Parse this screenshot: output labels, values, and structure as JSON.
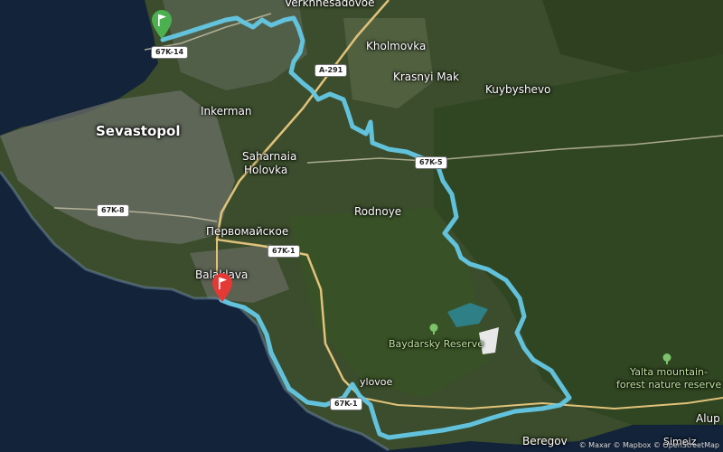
{
  "map": {
    "route_color": "#64c8e6",
    "start_marker": {
      "icon": "start-flag-icon",
      "color": "#4caf50"
    },
    "end_marker": {
      "icon": "finish-flag-icon",
      "color": "#e53935"
    },
    "cities": {
      "sevastopol": "Sevastopol"
    },
    "towns": {
      "verkhnesadovoe": "Verkhnesadovoe",
      "kholmovka": "Kholmovka",
      "krasnyi_mak": "Krasnyi Mak",
      "kuybyshevo": "Kuybyshevo",
      "inkerman": "Inkerman",
      "saharnaia": "Saharnaia",
      "holovka": "Holovka",
      "rodnoye": "Rodnoye",
      "pervomaiskoe": "Первомайское",
      "balaklava": "Balaklava",
      "foros_area": "ylovoe",
      "beregove": "Beregov",
      "alupka": "Alup",
      "simeiz": "Simeiz"
    },
    "parks": {
      "baydarsky": "Baydarsky Reserve",
      "yalta_line1": "Yalta mountain-",
      "yalta_line2": "forest nature reserve"
    },
    "roads": {
      "r67k14": "67K-14",
      "ra291": "A-291",
      "r67k5": "67K-5",
      "r67k8": "67K-8",
      "r67k1a": "67K-1",
      "r67k1b": "67K-1"
    },
    "attribution": "© Maxar © Mapbox © OpenStreetMap"
  }
}
